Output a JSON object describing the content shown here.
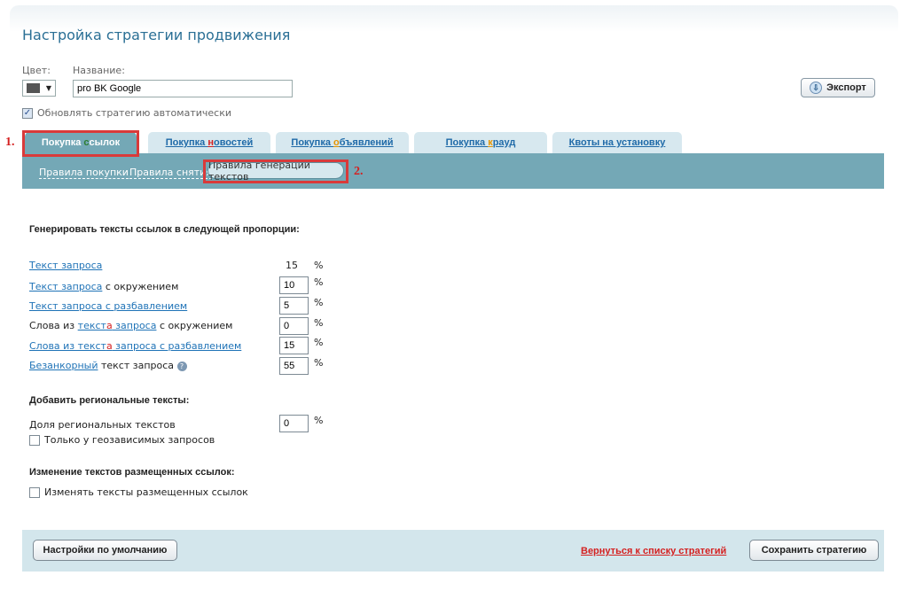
{
  "header": {
    "title": "Настройка стратегии продвижения"
  },
  "form": {
    "color_label": "Цвет:",
    "name_label": "Название:",
    "name_value": "pro BK Google",
    "export_label": "Экспорт",
    "auto_update_label": "Обновлять стратегию автоматически",
    "auto_update_checked": true
  },
  "markers": {
    "tab": "1.",
    "subtab": "2."
  },
  "tabs": [
    {
      "pre": "Покупка ",
      "hl": "с",
      "post": "сылок",
      "active": true
    },
    {
      "pre": "Покупка ",
      "hl": "н",
      "post": "овостей",
      "active": false
    },
    {
      "pre": "Покупка ",
      "hl": "о",
      "post": "бъявлений",
      "active": false
    },
    {
      "pre": "Покупка ",
      "hl": "к",
      "post": "рауд",
      "active": false
    },
    {
      "pre": "Квоты на установку",
      "hl": "",
      "post": "",
      "active": false
    }
  ],
  "subtabs": {
    "buy_rules": "Правила покупки",
    "removal_rules": "Правила снятия",
    "text_rules": "Правила генерации текстов"
  },
  "section1": {
    "title": "Генерировать тексты ссылок в следующей пропорции:",
    "pct": "%",
    "rows": [
      {
        "link": "Текст запроса",
        "tail": "",
        "value": "15"
      },
      {
        "link": "Текст запроса",
        "tail": " с окружением",
        "value": "10"
      },
      {
        "link": "Текст запроса с разбавлением",
        "tail": "",
        "value": "5"
      },
      {
        "pre": "Слова из ",
        "link_a": "текст",
        "link_red": "а",
        "link_b": " запроса",
        "tail": " с окружением",
        "value": "0"
      },
      {
        "link_a": "Слова из текст",
        "link_red": "а",
        "link_b": " запроса с разбавлением",
        "value": "15"
      },
      {
        "link": "Безанкорный",
        "tail": " текст запроса",
        "value": "55"
      }
    ]
  },
  "section2": {
    "title": "Добавить региональные тексты:",
    "share_label": "Доля региональных текстов",
    "share_value": "0",
    "geo_label": "Только у геозависимых запросов"
  },
  "section3": {
    "title": "Изменение текстов размещенных ссылок:",
    "change_label": "Изменять тексты размещенных ссылок"
  },
  "footer": {
    "defaults_label": "Настройки по умолчанию",
    "back_label": "Вернуться к списку стратегий",
    "save_label": "Сохранить стратегию"
  },
  "icons": {
    "export": "export-arrow-icon",
    "help": "help-icon",
    "dropdown": "chevron-down-icon"
  },
  "colors": {
    "accent": "#74a8b6",
    "tab_inactive": "#d7e8ef",
    "link": "#1f73b7",
    "marker_red": "#d42020",
    "swatch": "#555555"
  }
}
